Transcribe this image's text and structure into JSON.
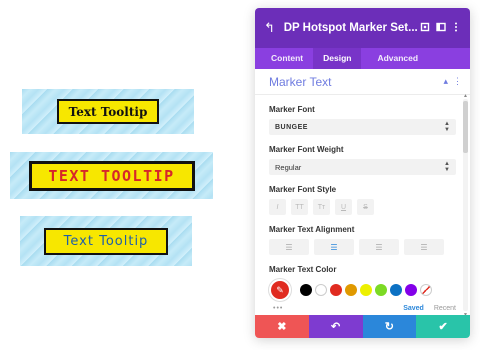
{
  "samples": [
    {
      "text": "Text Tooltip"
    },
    {
      "text": "TEXT TOOLTIP"
    },
    {
      "text": "Text Tooltip"
    }
  ],
  "panel": {
    "back_icon": "↰",
    "title": "DP Hotspot Marker Set...",
    "header_icons": [
      "expand-icon",
      "sidebar-icon",
      "more-icon"
    ],
    "tabs": [
      {
        "label": "Content"
      },
      {
        "label": "Design"
      },
      {
        "label": "Advanced"
      }
    ],
    "active_tab": "Design",
    "section_title": "Marker Text",
    "fields": {
      "font": {
        "label": "Marker Font",
        "value": "BUNGEE"
      },
      "weight": {
        "label": "Marker Font Weight",
        "value": "Regular"
      },
      "style": {
        "label": "Marker Font Style",
        "buttons": [
          "I",
          "TT",
          "Tт",
          "U",
          "S"
        ]
      },
      "align": {
        "label": "Marker Text Alignment",
        "buttons": [
          "left",
          "center",
          "right",
          "justify"
        ],
        "active": "center"
      },
      "color": {
        "label": "Marker Text Color",
        "swatches": [
          "#000000",
          "#ffffff",
          "#e02b20",
          "#e09900",
          "#edf000",
          "#7cda24",
          "#0c71c3",
          "#8300e9",
          "none"
        ],
        "saved_label": "Saved",
        "recent_label": "Recent",
        "selected_color": "#e02b20"
      }
    },
    "footer": [
      {
        "name": "cancel",
        "glyph": "✖",
        "color": "#ef5555"
      },
      {
        "name": "undo",
        "glyph": "↶",
        "color": "#7e3bd0"
      },
      {
        "name": "redo",
        "glyph": "↻",
        "color": "#2b87da"
      },
      {
        "name": "save",
        "glyph": "✔",
        "color": "#29c4a9"
      }
    ]
  }
}
